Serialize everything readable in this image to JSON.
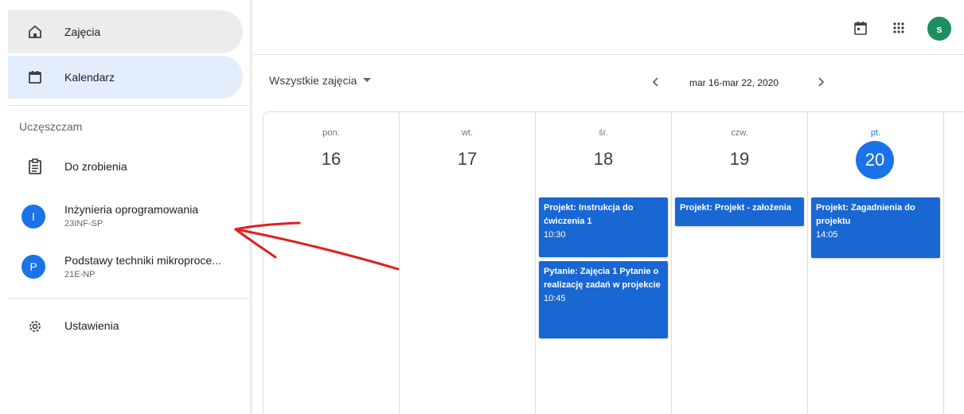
{
  "sidebar": {
    "home_label": "Zajęcia",
    "calendar_label": "Kalendarz",
    "section_label": "Uczęszczam",
    "todo_label": "Do zrobienia",
    "classes": [
      {
        "initial": "I",
        "name": "Inżynieria oprogramowania",
        "code": "23INF-SP"
      },
      {
        "initial": "P",
        "name": "Podstawy techniki mikroproce...",
        "code": "21E-NP"
      }
    ],
    "settings_label": "Ustawienia"
  },
  "topbar": {
    "user_initial": "s"
  },
  "toolbar": {
    "class_filter": "Wszystkie zajęcia",
    "date_range": "mar 16-mar 22, 2020",
    "prev": "‹",
    "next": "›"
  },
  "calendar": {
    "days": [
      {
        "abbr": "pon.",
        "num": "16"
      },
      {
        "abbr": "wt.",
        "num": "17"
      },
      {
        "abbr": "śr.",
        "num": "18"
      },
      {
        "abbr": "czw.",
        "num": "19"
      },
      {
        "abbr": "pt.",
        "num": "20"
      }
    ],
    "events": [
      {
        "title": "Projekt: Instrukcja do ćwiczenia 1",
        "time": "10:30"
      },
      {
        "title": "Pytanie: Zajęcia 1 Pytanie o realizację zadań w projekcie",
        "time": "10:45"
      },
      {
        "title": "Projekt: Projekt - założenia",
        "time": ""
      },
      {
        "title": "Projekt: Zagadnienia do projektu",
        "time": "14:05"
      }
    ]
  },
  "colors": {
    "accent": "#1a73e8",
    "event": "#1967d2",
    "user_avatar": "#1e8e5e",
    "annotation_arrow": "#e02020"
  }
}
